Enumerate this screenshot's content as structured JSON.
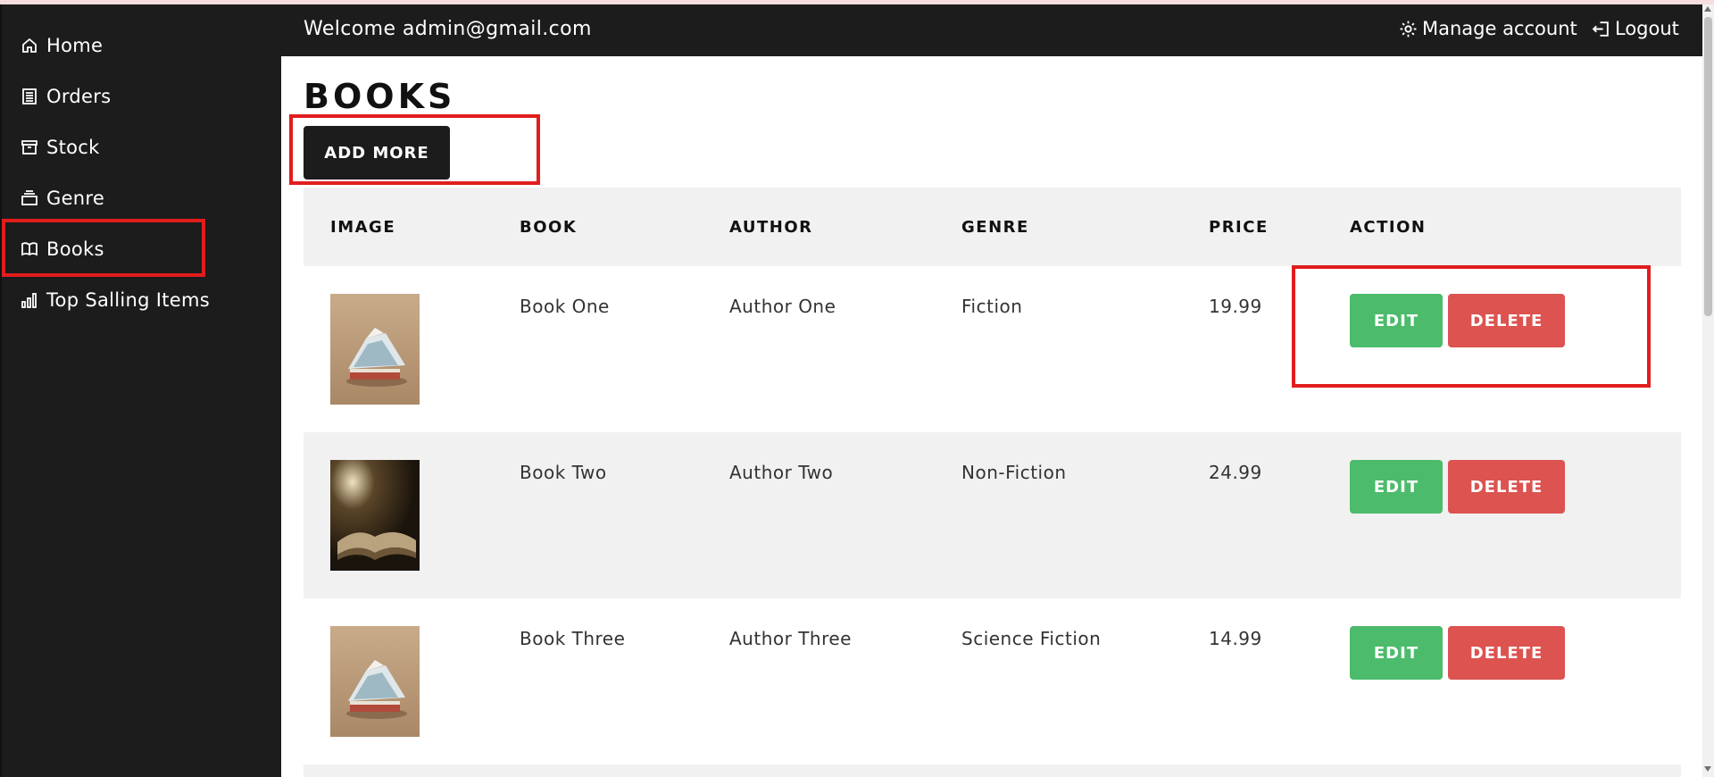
{
  "sidebar": {
    "items": [
      {
        "label": "Home",
        "icon": "home-icon"
      },
      {
        "label": "Orders",
        "icon": "orders-icon"
      },
      {
        "label": "Stock",
        "icon": "stock-icon"
      },
      {
        "label": "Genre",
        "icon": "genre-icon"
      },
      {
        "label": "Books",
        "icon": "book-icon",
        "active": true
      },
      {
        "label": "Top Salling Items",
        "icon": "bar-chart-icon"
      }
    ]
  },
  "header": {
    "welcome": "Welcome admin@gmail.com",
    "manage_account": "Manage account",
    "logout": "Logout"
  },
  "main": {
    "title": "BOOKS",
    "add_button": "ADD MORE",
    "columns": [
      "IMAGE",
      "BOOK",
      "AUTHOR",
      "GENRE",
      "PRICE",
      "ACTION"
    ],
    "rows": [
      {
        "image": "book-thumbnail-open-pages",
        "book": "Book One",
        "author": "Author One",
        "genre": "Fiction",
        "price": "19.99"
      },
      {
        "image": "book-thumbnail-dark-open-book",
        "book": "Book Two",
        "author": "Author Two",
        "genre": "Non-Fiction",
        "price": "24.99"
      },
      {
        "image": "book-thumbnail-open-pages",
        "book": "Book Three",
        "author": "Author Three",
        "genre": "Science Fiction",
        "price": "14.99"
      }
    ],
    "edit_label": "EDIT",
    "delete_label": "DELETE"
  },
  "colors": {
    "sidebar_bg": "#1c1c1c",
    "edit": "#4cbb6c",
    "delete": "#dc5350",
    "highlight": "#e11d1d",
    "row_alt": "#f1f1f1"
  }
}
